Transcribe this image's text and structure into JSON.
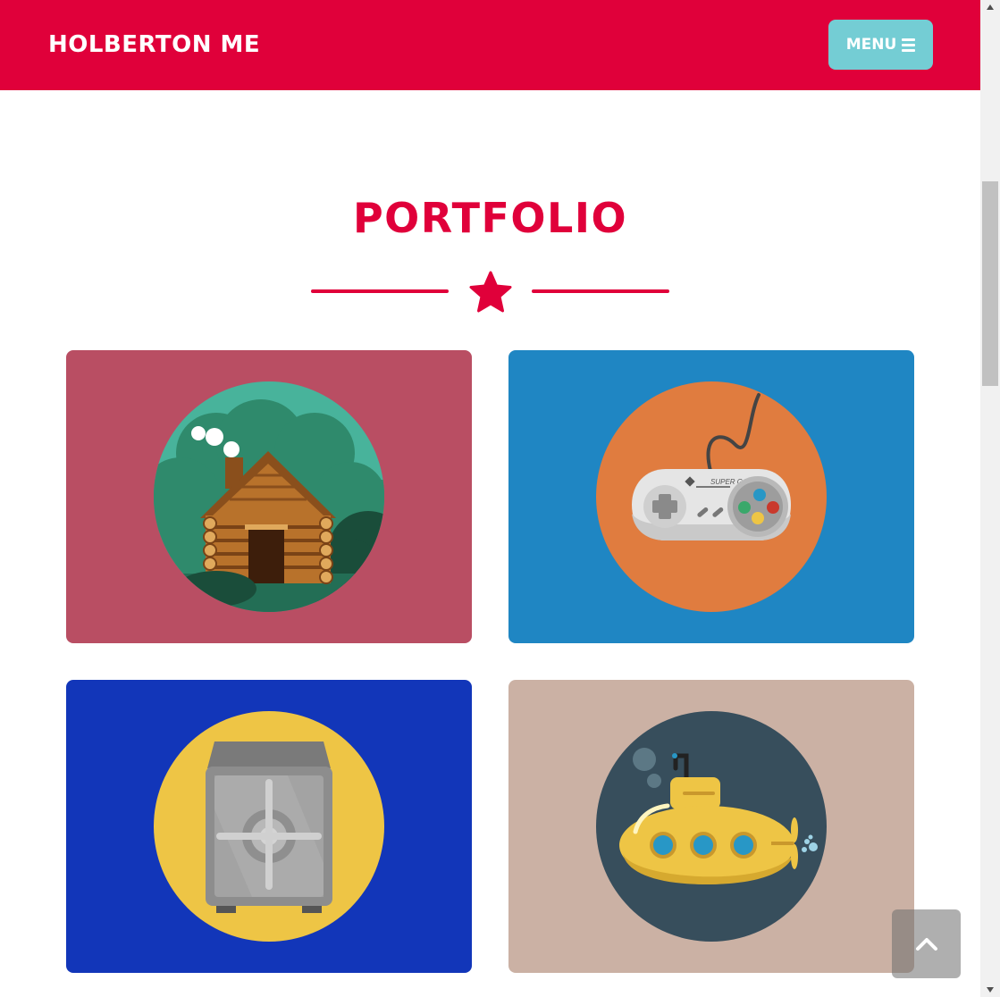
{
  "navbar": {
    "brand": "HOLBERTON ME",
    "menu_label": "MENU",
    "menu_icon": "bars-icon",
    "background": "#e0003a",
    "button_color": "#74cdd4"
  },
  "section": {
    "title": "PORTFOLIO",
    "divider_icon": "star-icon",
    "accent": "#e0003a"
  },
  "portfolio": [
    {
      "id": "cabin",
      "background": "#b94e63",
      "circle": "#2e8a6e",
      "icon": "cabin-icon"
    },
    {
      "id": "game",
      "background": "#1f86c3",
      "circle": "#e07c3f",
      "icon": "game-controller-icon",
      "controller_text": "SUPER GAME"
    },
    {
      "id": "safe",
      "background": "#1236b9",
      "circle": "#eec545",
      "icon": "safe-icon"
    },
    {
      "id": "submarine",
      "background": "#cbb1a4",
      "circle": "#374e5c",
      "icon": "submarine-icon"
    }
  ],
  "back_to_top": {
    "icon": "chevron-up-icon"
  }
}
